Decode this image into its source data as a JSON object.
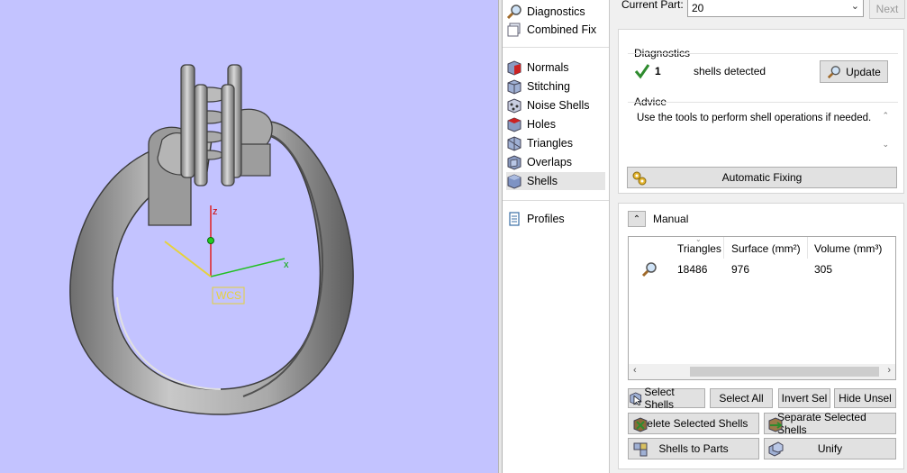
{
  "viewport": {
    "axis_z": "z",
    "axis_x": "x",
    "wcs_label": "WCS"
  },
  "nav": {
    "items": [
      {
        "label": "Diagnostics",
        "icon": "magnifier-icon"
      },
      {
        "label": "Combined Fix",
        "icon": "combined-fix-icon"
      },
      {
        "label": "Normals",
        "icon": "normals-cube-icon"
      },
      {
        "label": "Stitching",
        "icon": "stitching-cube-icon"
      },
      {
        "label": "Noise Shells",
        "icon": "noise-shells-cube-icon"
      },
      {
        "label": "Holes",
        "icon": "holes-cube-icon"
      },
      {
        "label": "Triangles",
        "icon": "triangles-cube-icon"
      },
      {
        "label": "Overlaps",
        "icon": "overlaps-cube-icon"
      },
      {
        "label": "Shells",
        "icon": "shells-cube-icon"
      },
      {
        "label": "Profiles",
        "icon": "profiles-doc-icon"
      }
    ],
    "selected": "Shells"
  },
  "header": {
    "current_part_label": "Current Part:",
    "current_part_value": "20",
    "next_label": "Next"
  },
  "diagnostics": {
    "title": "Diagnostics",
    "count": "1",
    "status_text": "shells detected",
    "update_label": "Update"
  },
  "advice": {
    "title": "Advice",
    "text": "Use the tools to perform shell operations if needed."
  },
  "automatic_fixing_label": "Automatic Fixing",
  "manual": {
    "title": "Manual",
    "columns": [
      "Triangles",
      "Surface (mm²)",
      "Volume (mm³)"
    ],
    "rows": [
      {
        "triangles": "18486",
        "surface": "976",
        "volume": "305"
      }
    ]
  },
  "actions": {
    "select_shells": "Select Shells",
    "select_all": "Select All",
    "invert_sel": "Invert Sel",
    "hide_unsel": "Hide Unsel",
    "delete_selected": "Delete Selected Shells",
    "separate_selected": "Separate Selected Shells",
    "shells_to_parts": "Shells to Parts",
    "unify": "Unify"
  },
  "colors": {
    "viewport_bg": "#c3c3ff",
    "check_green": "#2e8b2e"
  }
}
